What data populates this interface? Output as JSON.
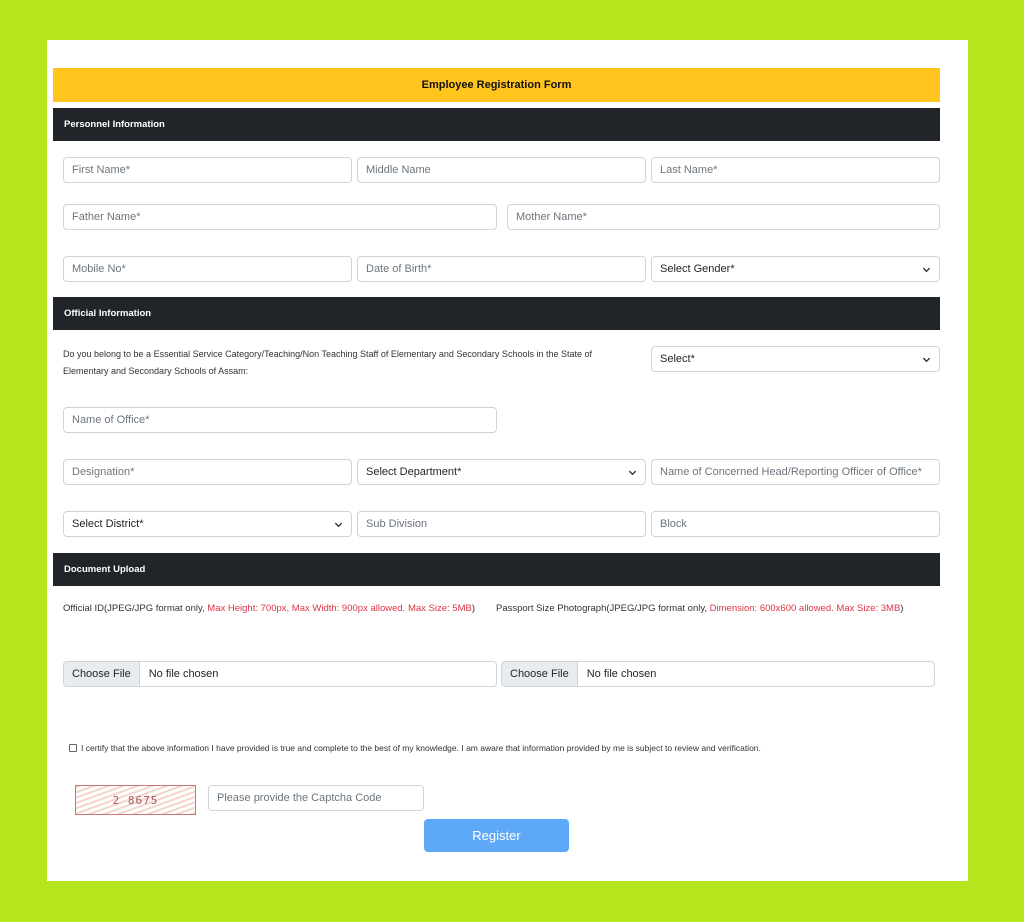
{
  "form": {
    "title": "Employee Registration Form",
    "sections": {
      "personnel": "Personnel Information",
      "official": "Official Information",
      "documents": "Document Upload"
    },
    "personnel_fields": {
      "first_name": "First Name*",
      "middle_name": "Middle Name",
      "last_name": "Last Name*",
      "father_name": "Father Name*",
      "mother_name": "Mother Name*",
      "mobile": "Mobile No*",
      "dob": "Date of Birth*",
      "gender": "Select Gender*"
    },
    "official_fields": {
      "question": "Do you belong to be a Essential Service Category/Teaching/Non Teaching Staff of Elementary and Secondary Schools in the State of Elementary and Secondary Schools of Assam:",
      "category_select": "Select*",
      "office_name": "Name of Office*",
      "designation": "Designation*",
      "department": "Select Department*",
      "head_officer": "Name of Concerned Head/Reporting Officer of Office*",
      "district": "Select District*",
      "sub_division": "Sub Division",
      "block": "Block"
    },
    "documents": {
      "official_id_prefix": "Official ID(JPEG/JPG format only, ",
      "official_id_red": "Max Height: 700px, Max Width: 900px allowed. Max Size: 5MB",
      "official_id_suffix": ")",
      "photo_prefix": "Passport Size Photograph(JPEG/JPG format only, ",
      "photo_red": "Dimension: 600x600 allowed. Max Size: 3MB",
      "photo_suffix": ")",
      "choose_file": "Choose File",
      "no_file": "No file chosen"
    },
    "certify_text": "I certify that the above information I have provided is true and complete to the best of my knowledge. I am aware that information provided by me is subject to review and verification.",
    "captcha_text": "2 8675",
    "captcha_placeholder": "Please provide the Captcha Code",
    "register_label": "Register"
  },
  "colors": {
    "background": "#b5e61d",
    "title_bar": "#ffc41e",
    "section_bar": "#212529",
    "required_note": "#dc3545",
    "register_button": "#5ea8f8"
  }
}
